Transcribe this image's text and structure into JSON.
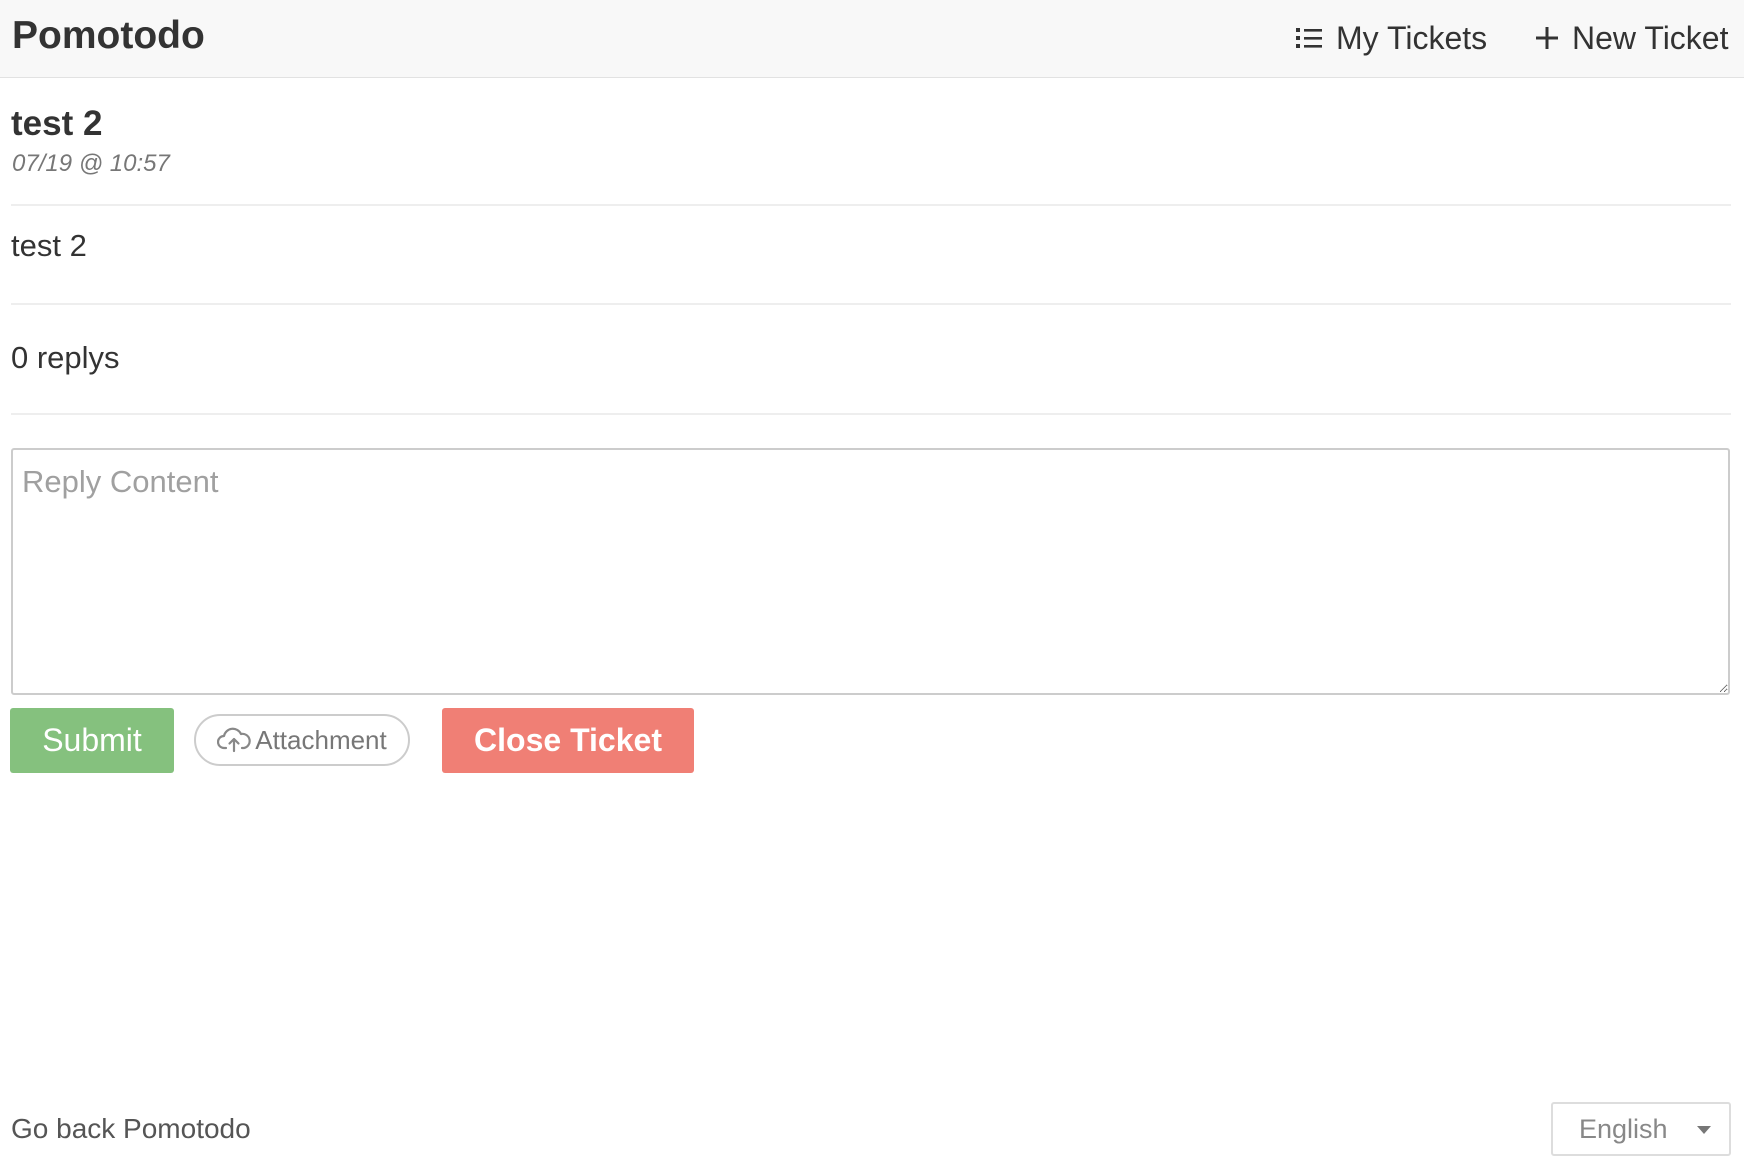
{
  "header": {
    "brand": "Pomotodo",
    "nav": {
      "my_tickets": {
        "label": "My Tickets",
        "icon": "list-icon"
      },
      "new_ticket": {
        "label": "New Ticket",
        "icon": "plus-icon"
      }
    }
  },
  "ticket": {
    "title": "test 2",
    "timestamp": "07/19 @ 10:57",
    "body": "test 2",
    "reply_count_text": "0 replys"
  },
  "reply_form": {
    "placeholder": "Reply Content",
    "value": "",
    "submit_label": "Submit",
    "attachment_label": "Attachment",
    "attachment_icon": "cloud-upload-icon",
    "close_label": "Close Ticket"
  },
  "footer": {
    "back_link": "Go back Pomotodo",
    "language": {
      "selected": "English"
    }
  },
  "colors": {
    "submit": "#85c17e",
    "close": "#f07f75",
    "header_bg": "#f8f8f8"
  }
}
